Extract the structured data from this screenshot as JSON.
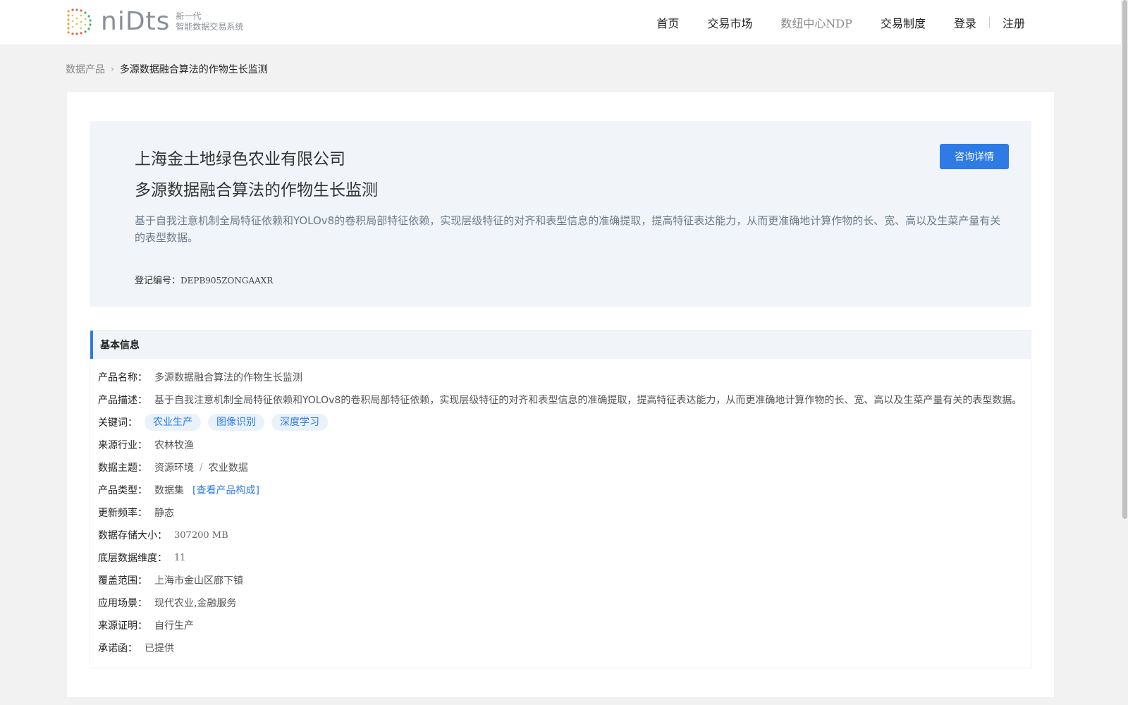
{
  "header": {
    "logo_word": "niDts",
    "logo_sub_line1": "新一代",
    "logo_sub_line2": "智能数据交易系统",
    "nav": [
      "首页",
      "交易市场",
      "数纽中心NDP",
      "交易制度"
    ],
    "login": "登录",
    "register": "注册"
  },
  "breadcrumb": {
    "parent": "数据产品",
    "current": "多源数据融合算法的作物生长监测"
  },
  "hero": {
    "company": "上海金土地绿色农业有限公司",
    "title": "多源数据融合算法的作物生长监测",
    "description": "基于自我注意机制全局特征依赖和YOLOv8的卷积局部特征依赖，实现层级特征的对齐和表型信息的准确提取，提高特征表达能力，从而更准确地计算作物的长、宽、高以及生菜产量有关的表型数据。",
    "reg_label": "登记编号：",
    "reg_value": "DEPB905ZONGAAXR",
    "consult_button": "咨询详情"
  },
  "info": {
    "heading": "基本信息",
    "product_name_label": "产品名称：",
    "product_name": "多源数据融合算法的作物生长监测",
    "product_desc_label": "产品描述：",
    "product_desc": "基于自我注意机制全局特征依赖和YOLOv8的卷积局部特征依赖，实现层级特征的对齐和表型信息的准确提取，提高特征表达能力，从而更准确地计算作物的长、宽、高以及生菜产量有关的表型数据。",
    "keywords_label": "关键词：",
    "keywords": [
      "农业生产",
      "图像识别",
      "深度学习"
    ],
    "industry_label": "来源行业：",
    "industry": "农林牧渔",
    "theme_label": "数据主题：",
    "theme_main": "资源环境",
    "theme_sep": "/",
    "theme_sub": "农业数据",
    "type_label": "产品类型：",
    "type": "数据集",
    "type_link": "[查看产品构成]",
    "freq_label": "更新频率：",
    "freq": "静态",
    "storage_label": "数据存储大小：",
    "storage": "307200 MB",
    "dims_label": "底层数据维度：",
    "dims": "11",
    "coverage_label": "覆盖范围：",
    "coverage": "上海市金山区廊下镇",
    "scenario_label": "应用场景：",
    "scenario": "现代农业,金融服务",
    "proof_label": "来源证明：",
    "proof": "自行生产",
    "letter_label": "承诺函：",
    "letter": "已提供"
  },
  "colors": {
    "accent": "#2e7be6",
    "hero_bg": "#f1f5f9",
    "page_bg": "#f2f2f2"
  }
}
